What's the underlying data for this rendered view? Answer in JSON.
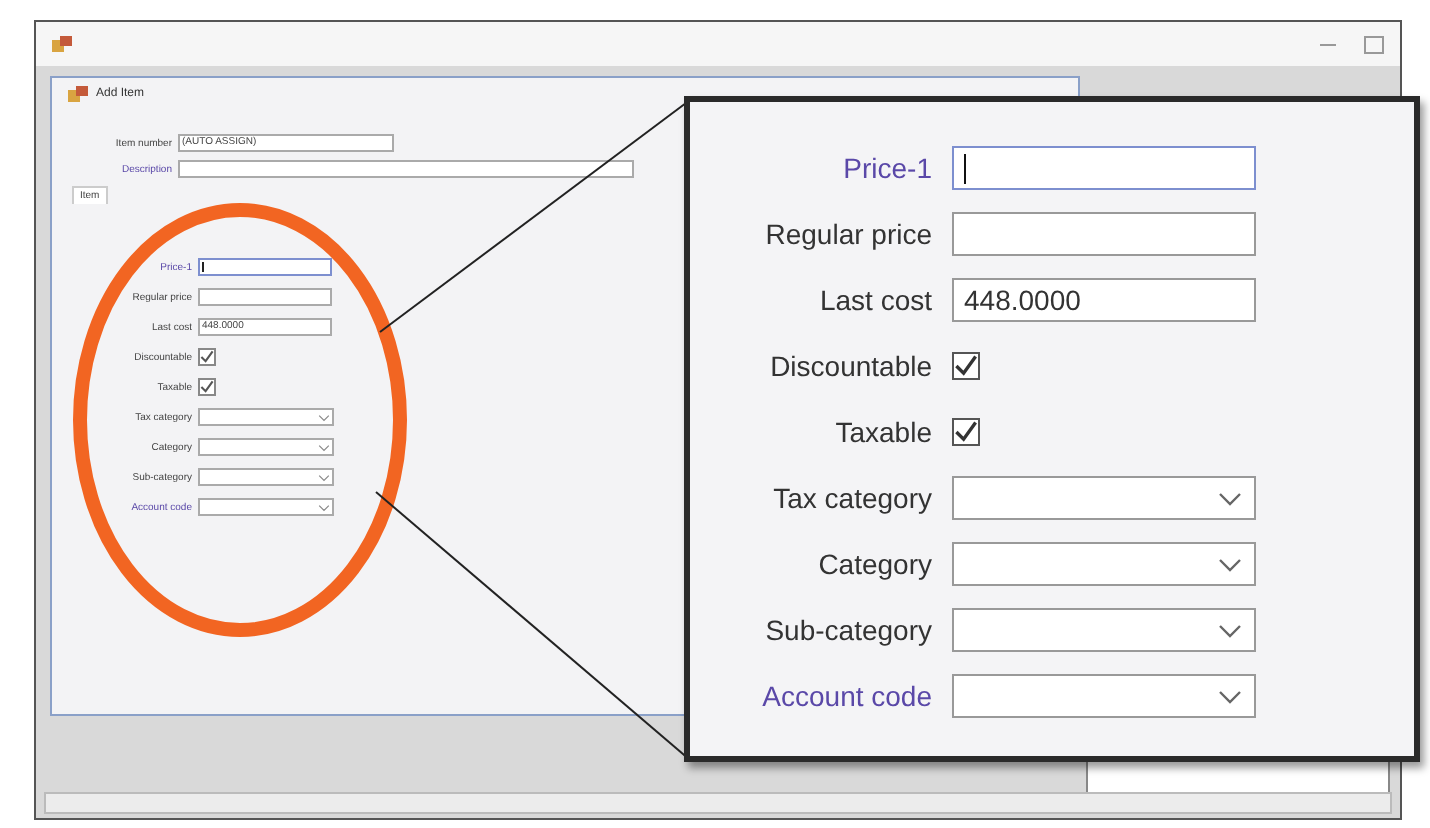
{
  "dialog": {
    "title": "Add Item",
    "item_number_label": "Item number",
    "item_number": "(AUTO ASSIGN)",
    "description_label": "Description",
    "tabs": [
      {
        "label": "Item",
        "selected": true
      }
    ],
    "fields": [
      {
        "kind": "text",
        "label": "Price-1",
        "highlighted": true,
        "focused": true
      },
      {
        "kind": "text",
        "label": "Regular price",
        "highlighted": false,
        "focused": false
      },
      {
        "kind": "text",
        "label": "Last cost",
        "value": "448.0000",
        "highlighted": false,
        "focused": false
      },
      {
        "kind": "checkbox",
        "label": "Discountable",
        "checked": true,
        "highlighted": false
      },
      {
        "kind": "checkbox",
        "label": "Taxable",
        "checked": true,
        "highlighted": false
      },
      {
        "kind": "dropdown",
        "label": "Tax category",
        "highlighted": false
      },
      {
        "kind": "dropdown",
        "label": "Category",
        "highlighted": false
      },
      {
        "kind": "dropdown",
        "label": "Sub-category",
        "highlighted": false
      },
      {
        "kind": "dropdown",
        "label": "Account code",
        "highlighted": true
      }
    ]
  },
  "callout": {
    "fields": [
      {
        "kind": "text",
        "label": "Price-1",
        "highlighted": true,
        "focused": true
      },
      {
        "kind": "text",
        "label": "Regular price",
        "highlighted": false,
        "focused": false
      },
      {
        "kind": "text",
        "label": "Last cost",
        "value": "448.0000",
        "highlighted": false,
        "focused": false
      },
      {
        "kind": "checkbox",
        "label": "Discountable",
        "checked": true,
        "highlighted": false
      },
      {
        "kind": "checkbox",
        "label": "Taxable",
        "checked": true,
        "highlighted": false
      },
      {
        "kind": "dropdown",
        "label": "Tax category",
        "highlighted": false
      },
      {
        "kind": "dropdown",
        "label": "Category",
        "highlighted": false
      },
      {
        "kind": "dropdown",
        "label": "Sub-category",
        "highlighted": false
      },
      {
        "kind": "dropdown",
        "label": "Account code",
        "highlighted": true
      }
    ]
  }
}
